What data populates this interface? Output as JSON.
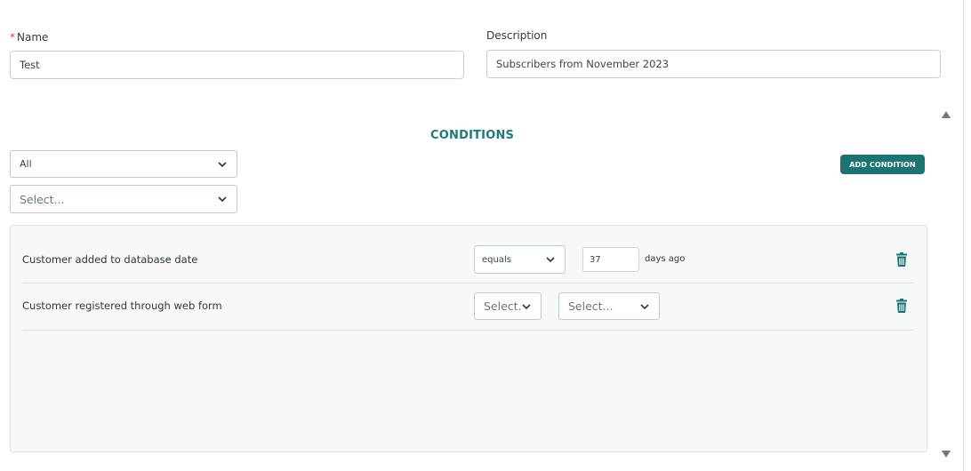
{
  "form": {
    "name_required_mark": "*",
    "name_label": "Name",
    "name_value": "Test",
    "description_label": "Description",
    "description_value": "Subscribers from November 2023"
  },
  "conditions": {
    "title": "CONDITIONS",
    "match_select_value": "All",
    "field_select_placeholder": "Select...",
    "add_button_label": "ADD CONDITION",
    "rows": [
      {
        "label": "Customer added to database date",
        "operator": "equals",
        "amount": "37",
        "unit": "days ago"
      },
      {
        "label": "Customer registered through web form",
        "operator_placeholder": "Select...",
        "value_placeholder": "Select..."
      }
    ]
  },
  "icons": {
    "delete": "trash-icon",
    "dropdown": "chevron-down-icon",
    "scroll_up": "triangle-up-icon",
    "scroll_down": "triangle-down-icon"
  },
  "colors": {
    "accent": "#1a7572",
    "required": "#e53935",
    "panel_bg": "#f6f8f9"
  }
}
